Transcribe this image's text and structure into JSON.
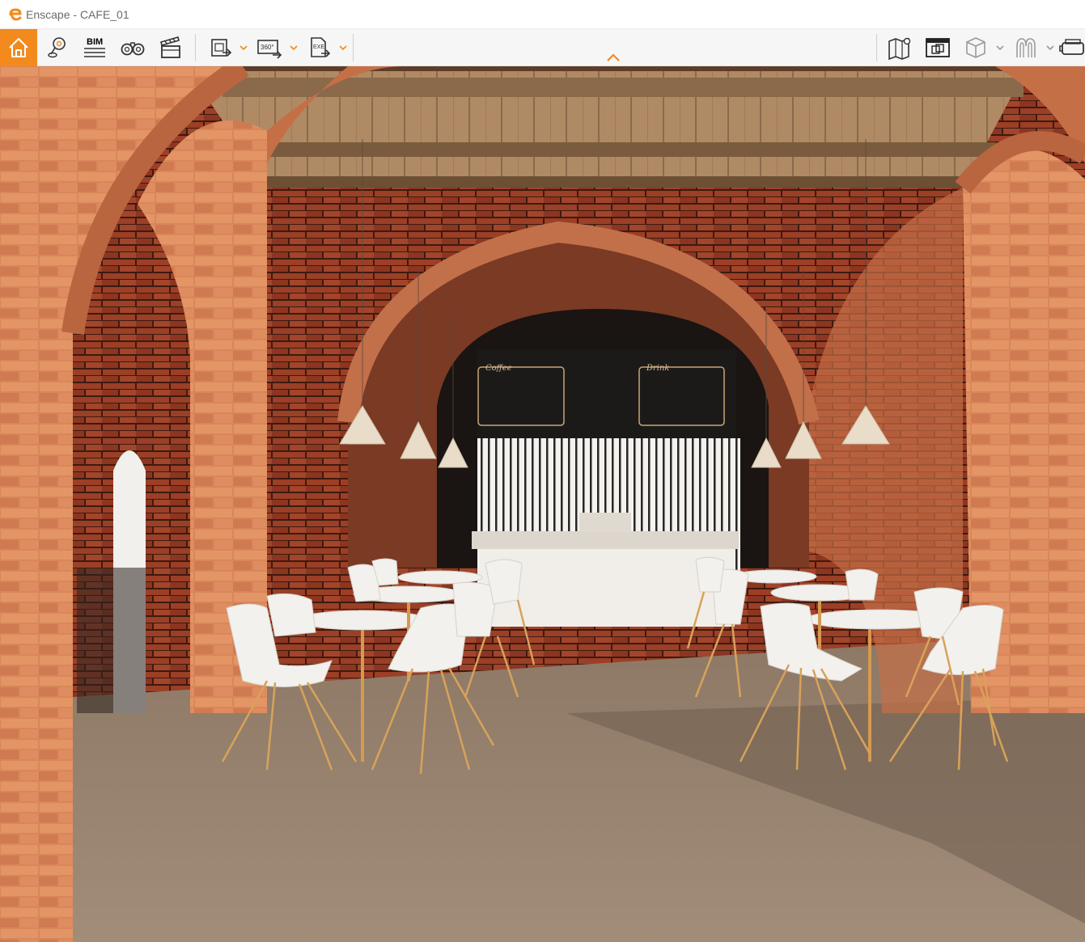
{
  "window": {
    "app_name": "Enscape",
    "separator": " - ",
    "project": "CAFE_01",
    "accent_color": "#f28a1d"
  },
  "toolbar": {
    "home_icon": "home-icon",
    "bim_label": "BIM",
    "pano_label": "360°",
    "exe_label": "EXE",
    "left_tools": [
      "home-icon",
      "location-pin-icon",
      "bim-icon",
      "binoculars-icon",
      "clapperboard-icon"
    ],
    "export_tools": [
      "screenshot-export-icon",
      "panorama-export-icon",
      "exe-export-icon"
    ],
    "right_tools": [
      "map-icon",
      "visual-settings-icon",
      "cube-view-icon",
      "arch-view-icon",
      "vr-headset-icon"
    ]
  },
  "scene": {
    "menu_board_left": "Coffee",
    "menu_board_right": "Drink"
  }
}
